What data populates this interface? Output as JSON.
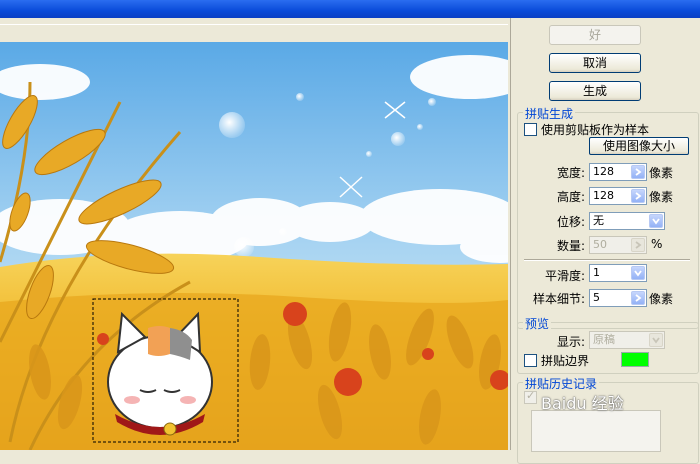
{
  "buttons": {
    "ok": "好",
    "cancel": "取消",
    "generate": "生成"
  },
  "tile_generation": {
    "legend": "拼贴生成",
    "use_clipboard_label": "使用剪贴板作为样本",
    "use_clipboard_checked": false,
    "use_image_size_button": "使用图像大小",
    "width_label": "宽度:",
    "width_value": "128",
    "width_unit": "像素",
    "height_label": "高度:",
    "height_value": "128",
    "height_unit": "像素",
    "offset_label": "位移:",
    "offset_value": "无",
    "amount_label": "数量:",
    "amount_value": "50",
    "amount_unit": "%",
    "smoothness_label": "平滑度:",
    "smoothness_value": "1",
    "sample_detail_label": "样本细节:",
    "sample_detail_value": "5",
    "sample_detail_unit": "像素"
  },
  "preview": {
    "legend": "预览",
    "show_label": "显示:",
    "show_value": "原稿",
    "tile_borders_label": "拼贴边界",
    "tile_borders_checked": false,
    "border_color": "#00ff00"
  },
  "history": {
    "legend": "拼贴历史记录",
    "save_preview_checked": true
  },
  "watermark": "Baidu 经验",
  "colors": {
    "titlebar": "#0a4bd9",
    "panel_bg": "#ece9d8",
    "legend_text": "#0046d5"
  }
}
